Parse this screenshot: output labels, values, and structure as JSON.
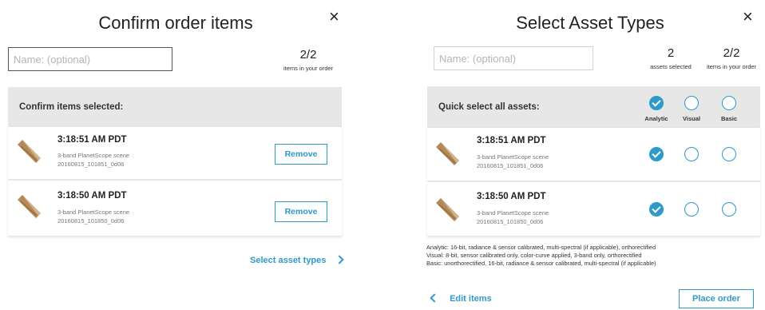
{
  "colors": {
    "accent": "#2f9ac9",
    "bar_bg": "#e7e7e7",
    "text": "#333333"
  },
  "left": {
    "title": "Confirm order items",
    "close_icon": "×",
    "name_placeholder": "Name: (optional)",
    "count_value": "2/2",
    "count_label": "items in your order",
    "section_label": "Confirm items selected:",
    "items": [
      {
        "time": "3:18:51 AM PDT",
        "desc1": "3-band PlanetScope scene",
        "desc2": "20160815_101851_0d06",
        "remove_label": "Remove"
      },
      {
        "time": "3:18:50 AM PDT",
        "desc1": "3-band PlanetScope scene",
        "desc2": "20160815_101850_0d06",
        "remove_label": "Remove"
      }
    ],
    "next_link": "Select asset types"
  },
  "right": {
    "title": "Select Asset Types",
    "close_icon": "×",
    "name_placeholder": "Name: (optional)",
    "assets_count": "2",
    "assets_label": "assets selected",
    "items_count": "2/2",
    "items_label": "items in your order",
    "quick_label": "Quick select all assets:",
    "asset_types": [
      {
        "label": "Analytic",
        "checked": true
      },
      {
        "label": "Visual",
        "checked": false
      },
      {
        "label": "Basic",
        "checked": false
      }
    ],
    "items": [
      {
        "time": "3:18:51 AM PDT",
        "desc1": "3-band PlanetScope scene",
        "desc2": "20160815_101851_0d06",
        "selection": [
          true,
          false,
          false
        ]
      },
      {
        "time": "3:18:50 AM PDT",
        "desc1": "3-band PlanetScope scene",
        "desc2": "20160815_101850_0d06",
        "selection": [
          true,
          false,
          false
        ]
      }
    ],
    "legend": [
      "Analytic: 16-bit, radiance & sensor calibrated, multi-spectral (if applicable), orthorectified",
      "Visual: 8-bit, sensor calibrated only, color-curve applied, 3-band only, orthorectified",
      "Basic: unorthorectified, 16-bit, radiance & sensor calibrated, multi-spectral (if applicable)"
    ],
    "back_link": "Edit items",
    "place_order": "Place order"
  }
}
